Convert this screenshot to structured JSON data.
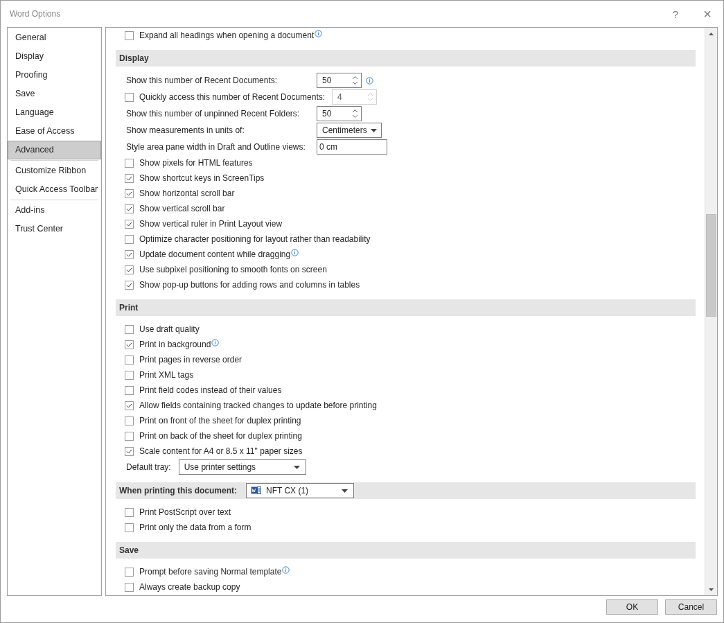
{
  "window": {
    "title": "Word Options",
    "help": "?",
    "close": "×"
  },
  "sidebar": {
    "groups": [
      [
        {
          "label": "General",
          "selected": false
        },
        {
          "label": "Display",
          "selected": false
        },
        {
          "label": "Proofing",
          "selected": false
        },
        {
          "label": "Save",
          "selected": false
        },
        {
          "label": "Language",
          "selected": false
        },
        {
          "label": "Ease of Access",
          "selected": false
        },
        {
          "label": "Advanced",
          "selected": true
        }
      ],
      [
        {
          "label": "Customize Ribbon",
          "selected": false
        },
        {
          "label": "Quick Access Toolbar",
          "selected": false
        }
      ],
      [
        {
          "label": "Add-ins",
          "selected": false
        },
        {
          "label": "Trust Center",
          "selected": false
        }
      ]
    ]
  },
  "content": {
    "items": [
      {
        "kind": "checkbox",
        "label": "Expand all headings when opening a document",
        "checked": false,
        "info": true
      },
      {
        "kind": "section",
        "label": "Display"
      },
      {
        "kind": "spin",
        "label": "Show this number of Recent Documents:",
        "value": "50",
        "info": true
      },
      {
        "kind": "spin",
        "label": "Quickly access this number of Recent Documents:",
        "value": "4",
        "checked": false,
        "disabled": true
      },
      {
        "kind": "spin",
        "label": "Show this number of unpinned Recent Folders:",
        "value": "50"
      },
      {
        "kind": "dropdown",
        "label": "Show measurements in units of:",
        "value": "Centimeters"
      },
      {
        "kind": "text",
        "label": "Style area pane width in Draft and Outline views:",
        "value": "0 cm"
      },
      {
        "kind": "checkbox",
        "label": "Show pixels for HTML features",
        "checked": false
      },
      {
        "kind": "checkbox",
        "label": "Show shortcut keys in ScreenTips",
        "checked": true
      },
      {
        "kind": "checkbox",
        "label": "Show horizontal scroll bar",
        "checked": true
      },
      {
        "kind": "checkbox",
        "label": "Show vertical scroll bar",
        "checked": true
      },
      {
        "kind": "checkbox",
        "label": "Show vertical ruler in Print Layout view",
        "checked": true
      },
      {
        "kind": "checkbox",
        "label": "Optimize character positioning for layout rather than readability",
        "checked": false
      },
      {
        "kind": "checkbox",
        "label": "Update document content while dragging",
        "checked": true,
        "info": true
      },
      {
        "kind": "checkbox",
        "label": "Use subpixel positioning to smooth fonts on screen",
        "checked": true
      },
      {
        "kind": "checkbox",
        "label": "Show pop-up buttons for adding rows and columns in tables",
        "checked": true
      },
      {
        "kind": "section",
        "label": "Print"
      },
      {
        "kind": "checkbox",
        "label": "Use draft quality",
        "checked": false
      },
      {
        "kind": "checkbox",
        "label": "Print in background",
        "checked": true,
        "info": true
      },
      {
        "kind": "checkbox",
        "label": "Print pages in reverse order",
        "checked": false
      },
      {
        "kind": "checkbox",
        "label": "Print XML tags",
        "checked": false
      },
      {
        "kind": "checkbox",
        "label": "Print field codes instead of their values",
        "checked": false
      },
      {
        "kind": "checkbox",
        "label": "Allow fields containing tracked changes to update before printing",
        "checked": true
      },
      {
        "kind": "checkbox",
        "label": "Print on front of the sheet for duplex printing",
        "checked": false
      },
      {
        "kind": "checkbox",
        "label": "Print on back of the sheet for duplex printing",
        "checked": false
      },
      {
        "kind": "checkbox",
        "label": "Scale content for A4 or 8.5 x 11\" paper sizes",
        "checked": true
      },
      {
        "kind": "inline-dropdown",
        "label": "Default tray:",
        "value": "Use printer settings"
      },
      {
        "kind": "section",
        "label": "When printing this document:",
        "document": "NFT CX (1)"
      },
      {
        "kind": "checkbox",
        "label": "Print PostScript over text",
        "checked": false
      },
      {
        "kind": "checkbox",
        "label": "Print only the data from a form",
        "checked": false
      },
      {
        "kind": "section",
        "label": "Save"
      },
      {
        "kind": "checkbox",
        "label": "Prompt before saving Normal template",
        "checked": false,
        "info": true
      },
      {
        "kind": "checkbox",
        "label": "Always create backup copy",
        "checked": false
      }
    ]
  },
  "buttons": [
    {
      "label": "OK"
    },
    {
      "label": "Cancel"
    }
  ]
}
